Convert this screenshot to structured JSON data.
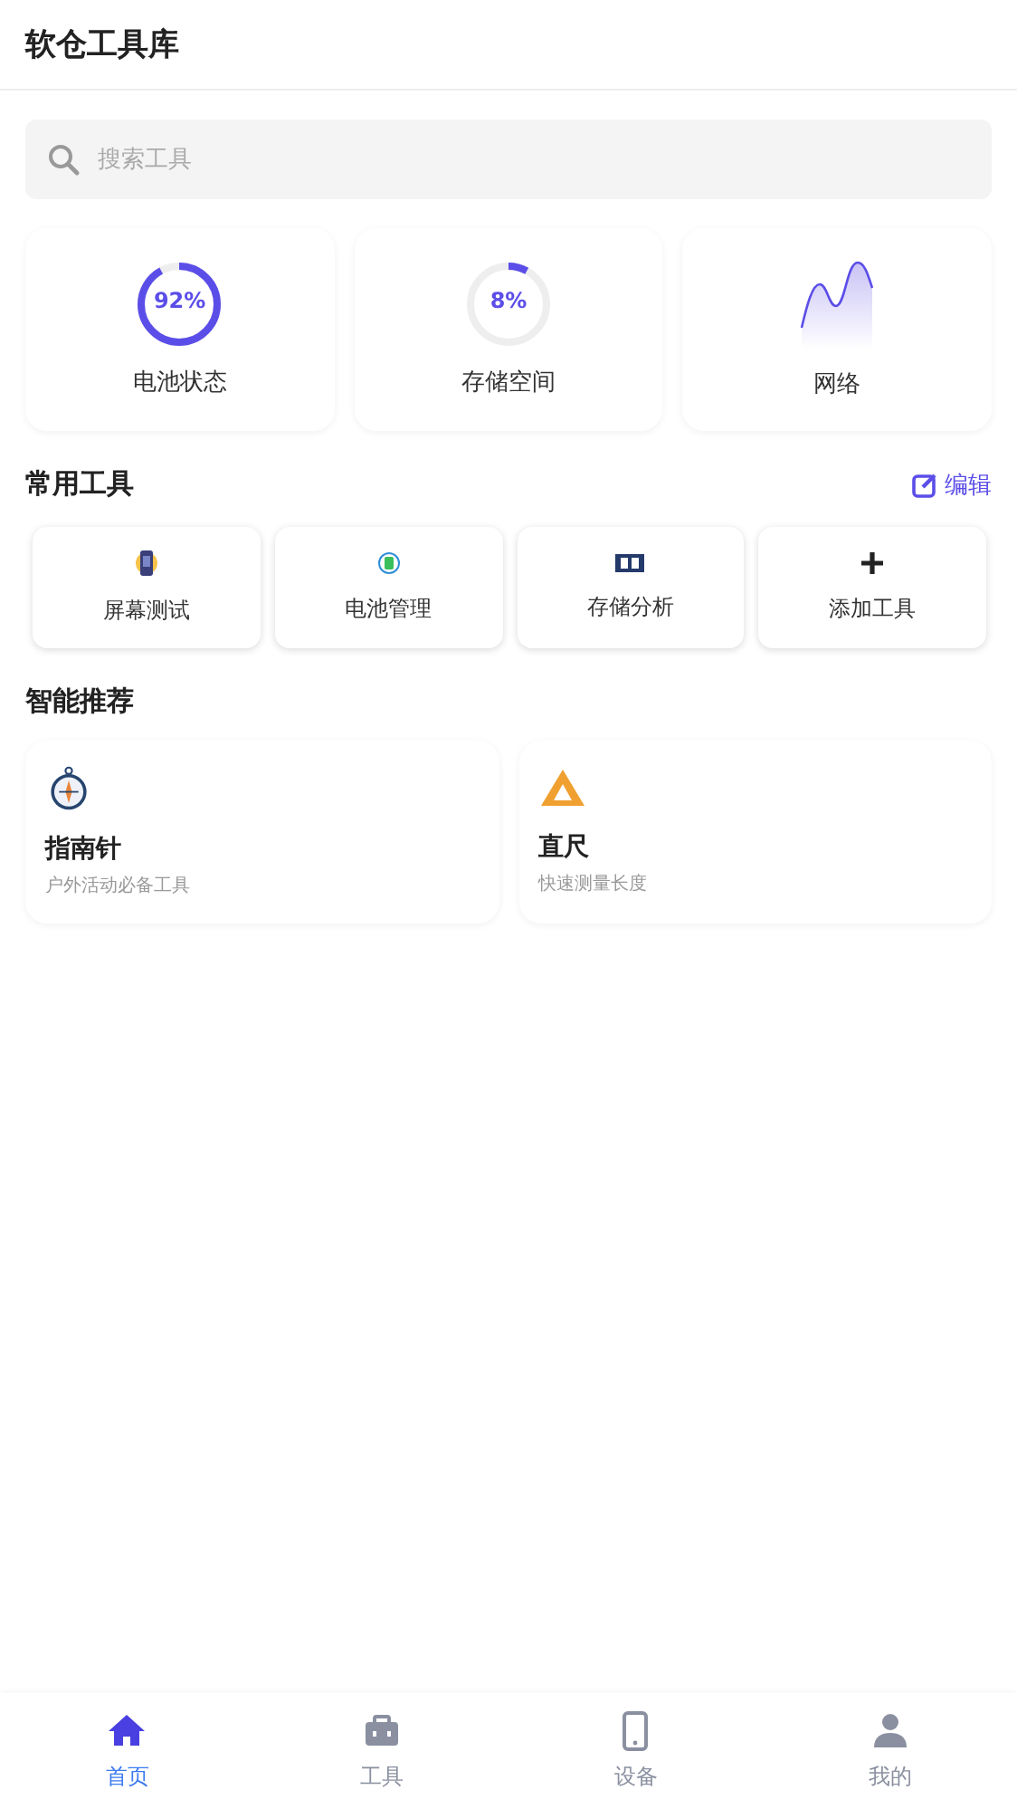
{
  "header": {
    "title": "软仓工具库"
  },
  "search": {
    "placeholder": "搜索工具"
  },
  "stats": [
    {
      "kind": "ring",
      "value": "92%",
      "label": "电池状态"
    },
    {
      "kind": "ring",
      "value": "8%",
      "label": "存储空间"
    },
    {
      "kind": "sparkline",
      "label": "网络"
    }
  ],
  "common_tools": {
    "title": "常用工具",
    "edit": "编辑",
    "items": [
      {
        "kind": "phone",
        "label": "屏幕测试"
      },
      {
        "kind": "battery",
        "label": "电池管理"
      },
      {
        "kind": "storage",
        "label": "存储分析"
      },
      {
        "kind": "add",
        "label": "添加工具"
      }
    ]
  },
  "recommend": {
    "title": "智能推荐",
    "items": [
      {
        "kind": "compass",
        "title": "指南针",
        "desc": "户外活动必备工具"
      },
      {
        "kind": "ruler",
        "title": "直尺",
        "desc": "快速测量长度"
      }
    ]
  },
  "nav": [
    {
      "kind": "home",
      "label": "首页",
      "selected": true
    },
    {
      "kind": "tools",
      "label": "工具",
      "selected": false
    },
    {
      "kind": "device",
      "label": "设备",
      "selected": false
    },
    {
      "kind": "user",
      "label": "我的",
      "selected": false
    }
  ]
}
